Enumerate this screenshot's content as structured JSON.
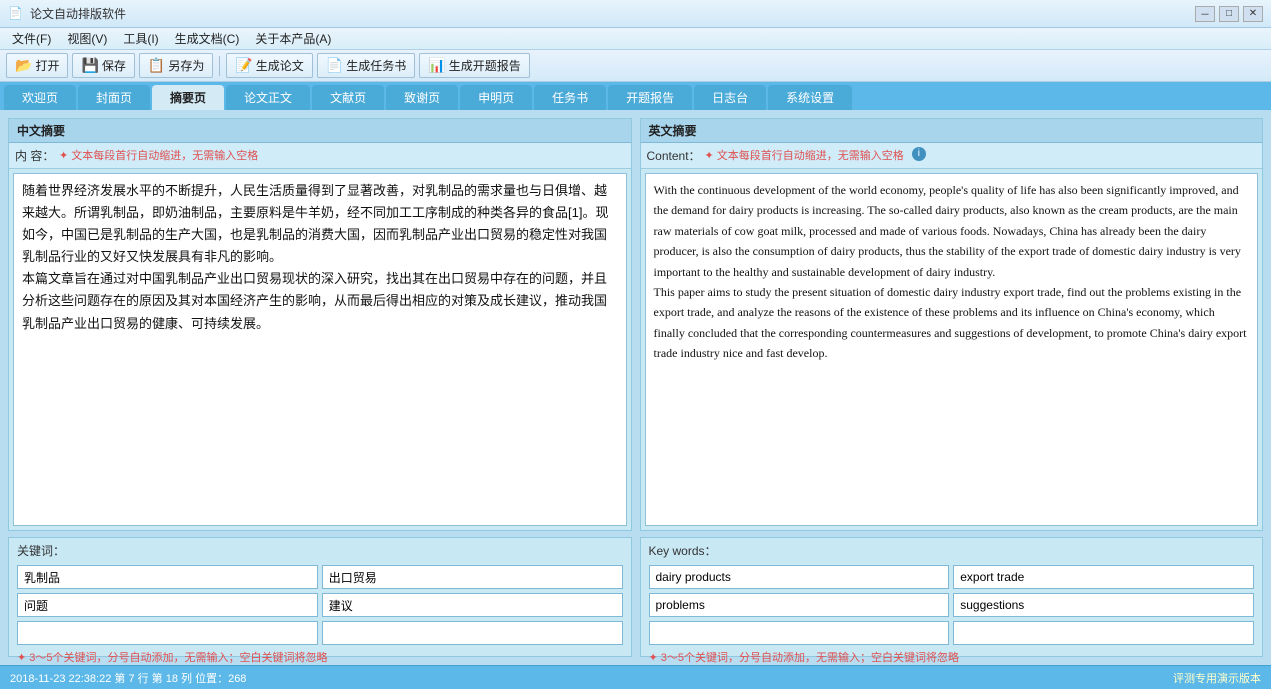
{
  "app": {
    "title": "论文自动排版软件",
    "icon": "📄"
  },
  "titlebar": {
    "controls": {
      "minimize": "－",
      "maximize": "□",
      "close": "✕"
    }
  },
  "menubar": {
    "items": [
      {
        "label": "文件(F)"
      },
      {
        "label": "视图(V)"
      },
      {
        "label": "工具(I)"
      },
      {
        "label": "生成文档(C)"
      },
      {
        "label": "关于本产品(A)"
      }
    ]
  },
  "toolbar": {
    "buttons": [
      {
        "icon": "📂",
        "label": "打开"
      },
      {
        "icon": "💾",
        "label": "保存"
      },
      {
        "icon": "📋",
        "label": "另存为"
      },
      {
        "icon": "📝",
        "label": "生成论文"
      },
      {
        "icon": "📄",
        "label": "生成任务书"
      },
      {
        "icon": "📊",
        "label": "生成开题报告"
      }
    ]
  },
  "tabs": {
    "items": [
      {
        "label": "欢迎页"
      },
      {
        "label": "封面页"
      },
      {
        "label": "摘要页"
      },
      {
        "label": "论文正文"
      },
      {
        "label": "文献页"
      },
      {
        "label": "致谢页"
      },
      {
        "label": "申明页"
      },
      {
        "label": "任务书"
      },
      {
        "label": "开题报告"
      },
      {
        "label": "日志台"
      },
      {
        "label": "系统设置"
      }
    ],
    "active": 2
  },
  "zh_abstract": {
    "section_title": "中文摘要",
    "label": "内  容：",
    "hint": "✦ 文本每段首行自动缩进，无需输入空格",
    "content": "随着世界经济发展水平的不断提升，人民生活质量得到了显著改善，对乳制品的需求量也与日俱增、越来越大。所谓乳制品，即奶油制品，主要原料是牛羊奶，经不同加工工序制成的种类各异的食品[1]。现如今，中国已是乳制品的生产大国，也是乳制品的消费大国，因而乳制品产业出口贸易的稳定性对我国乳制品行业的又好又快发展具有非凡的影响。\n本篇文章旨在通过对中国乳制品产业出口贸易现状的深入研究，找出其在出口贸易中存在的问题，并且分析这些问题存在的原因及其对本国经济产生的影响，从而最后得出相应的对策及成长建议，推动我国乳制品产业出口贸易的健康、可持续发展。"
  },
  "en_abstract": {
    "section_title": "英文摘要",
    "label": "Content：",
    "hint": "✦ 文本每段首行自动缩进，无需输入空格",
    "content": "With the continuous development of the world economy, people's quality of life has also been significantly improved, and the demand for dairy products is increasing. The so-called dairy products, also known as the cream products, are the main raw materials of cow goat milk, processed and made of various foods. Nowadays, China has already been the dairy producer, is also the consumption of dairy products, thus the stability of the export trade of domestic dairy industry is very important to the healthy and sustainable development of dairy industry.\nThis paper aims to study the present situation of domestic dairy industry export trade, find out the problems existing in the export trade, and analyze the reasons of the existence of these problems and its influence on China's economy, which finally concluded that the corresponding countermeasures and suggestions of development, to promote China's dairy export trade industry nice and fast develop."
  },
  "zh_keywords": {
    "title": "关键词：",
    "words": [
      "乳制品",
      "出口贸易",
      "问题",
      "建议",
      "",
      ""
    ],
    "hint": "✦ 3～5个关键词，分号自动添加，无需输入；空白关键词将忽略"
  },
  "en_keywords": {
    "title": "Key words：",
    "words": [
      "dairy products",
      "export trade",
      "problems",
      "suggestions",
      "",
      ""
    ],
    "hint": "✦ 3～5个关键词，分号自动添加，无需输入；空白关键词将忽略"
  },
  "statusbar": {
    "info": "2018-11-23  22:38:22    第 7 行 第 18 列  位置：268",
    "version": "评测专用演示版本"
  }
}
